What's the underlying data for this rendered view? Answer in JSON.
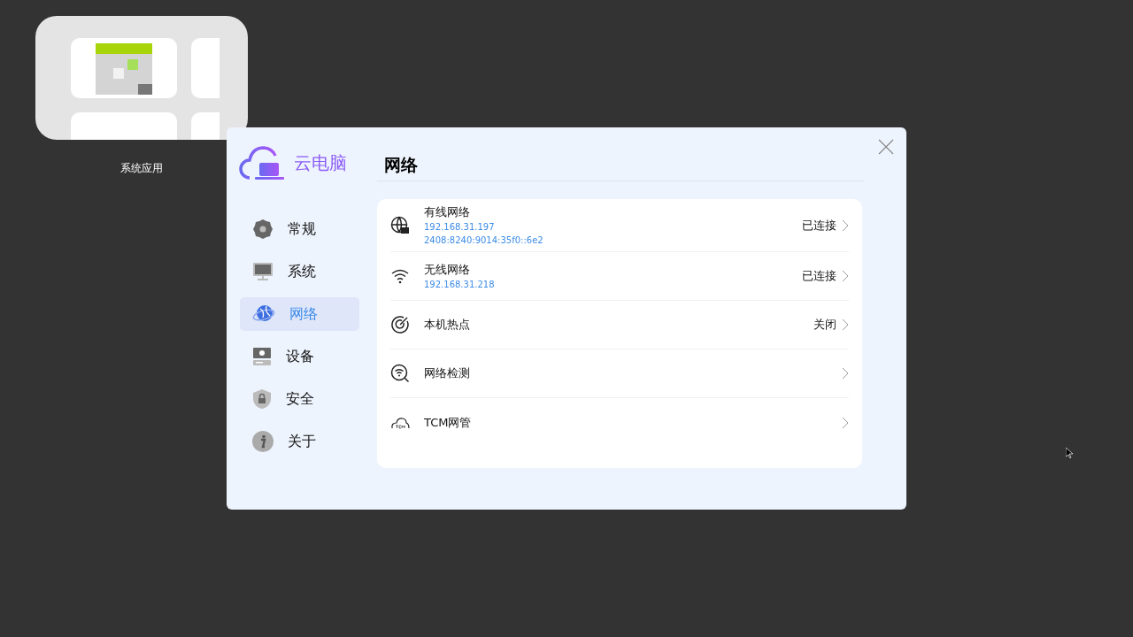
{
  "desktop": {
    "folder": {
      "label": "系统应用"
    }
  },
  "window": {
    "logo": "云电脑",
    "title": "网络"
  },
  "sidebar": {
    "items": [
      {
        "label": "常规",
        "selected": false
      },
      {
        "label": "系统",
        "selected": false
      },
      {
        "label": "网络",
        "selected": true
      },
      {
        "label": "设备",
        "selected": false
      },
      {
        "label": "安全",
        "selected": false
      },
      {
        "label": "关于",
        "selected": false
      }
    ]
  },
  "rows": [
    {
      "title": "有线网络",
      "details": [
        "192.168.31.197",
        "2408:8240:9014:35f0::6e2"
      ],
      "status": "已连接"
    },
    {
      "title": "无线网络",
      "details": [
        "192.168.31.218"
      ],
      "status": "已连接"
    },
    {
      "title": "本机热点",
      "status": "关闭"
    },
    {
      "title": "网络检测"
    },
    {
      "title": "TCM网管"
    }
  ]
}
